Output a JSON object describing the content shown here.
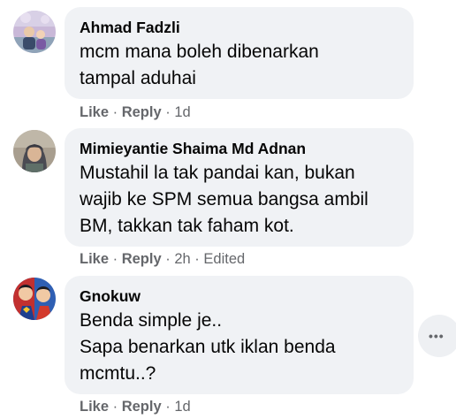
{
  "comments": [
    {
      "author": "Ahmad Fadzli",
      "text": "mcm mana boleh dibenarkan\ntampal aduhai",
      "like_label": "Like",
      "reply_label": "Reply",
      "separator": "·",
      "time": "1d",
      "edited": ""
    },
    {
      "author": "Mimieyantie Shaima Md Adnan",
      "text": "Mustahil la tak pandai kan, bukan\nwajib ke SPM semua bangsa ambil\nBM, takkan tak faham kot.",
      "like_label": "Like",
      "reply_label": "Reply",
      "separator": "·",
      "time": "2h",
      "edited": "Edited"
    },
    {
      "author": "Gnokuw",
      "text": "Benda simple je..\nSapa benarkan utk iklan benda\nmcmtu..?",
      "like_label": "Like",
      "reply_label": "Reply",
      "separator": "·",
      "time": "1d",
      "edited": ""
    }
  ],
  "more_button": {
    "icon": "more-horizontal-icon",
    "glyph": "•••"
  },
  "colors": {
    "bubble": "#f0f2f5",
    "meta_text": "#65676b",
    "body_text": "#050505"
  }
}
